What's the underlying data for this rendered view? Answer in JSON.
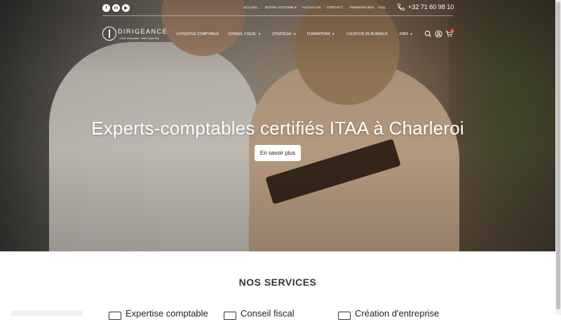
{
  "topbar": {
    "social": [
      {
        "label": "f",
        "icon": "facebook-icon"
      },
      {
        "label": "in",
        "icon": "linkedin-icon"
      },
      {
        "label": "▶",
        "icon": "youtube-icon"
      }
    ],
    "links": [
      "ACCUEIL",
      "NOTRE HISTOIRE",
      "ACTUALITÉ",
      "CONTACT",
      "PRENDRE RDV",
      "FAQ"
    ],
    "phone": "+32 71 60 98 10"
  },
  "logo": {
    "name": "DIRIGEANCE",
    "tagline": "Votre entreprise, notre expertise"
  },
  "nav": {
    "items": [
      {
        "label": "EXPERTISE COMPTABLE",
        "dropdown": false
      },
      {
        "label": "CONSEIL FISCAL",
        "dropdown": true
      },
      {
        "label": "STRATÉGIE",
        "dropdown": true
      },
      {
        "label": "FORMATIONS",
        "dropdown": true
      },
      {
        "label": "LOCATION DE BUREAUX",
        "dropdown": false
      },
      {
        "label": "JOBS",
        "dropdown": true
      }
    ],
    "cart_count": "0"
  },
  "hero": {
    "title": "Experts-comptables certifiés ITAA à Charleroi",
    "button": "En savoir plus"
  },
  "services": {
    "title": "NOS SERVICES",
    "items": [
      "Expertise comptable",
      "Conseil fiscal",
      "Création d'entreprise"
    ]
  }
}
